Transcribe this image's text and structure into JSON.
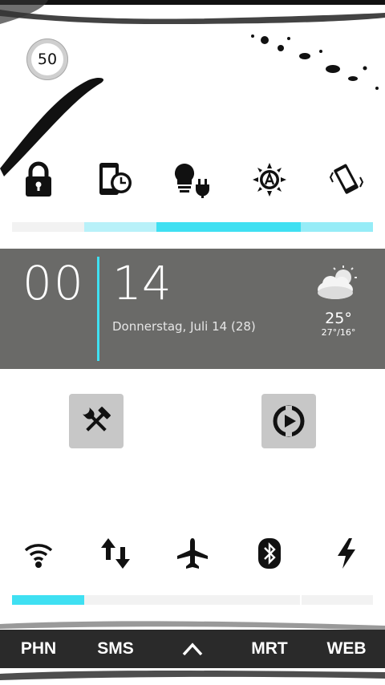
{
  "badge": {
    "value": "50"
  },
  "toggles_top": [
    {
      "icon": "lock-icon"
    },
    {
      "icon": "screen-timeout-icon"
    },
    {
      "icon": "bulb-plug-icon"
    },
    {
      "icon": "auto-brightness-icon"
    },
    {
      "icon": "vibrate-icon"
    }
  ],
  "brightness_bar": {
    "level_start": 0.2,
    "level_end": 1.0,
    "accent": "#3fe0f2"
  },
  "clock": {
    "hours": "00",
    "day": "14",
    "date": "Donnerstag, Juli 14 (28)"
  },
  "weather": {
    "icon": "partly-cloudy-icon",
    "temp": "25°",
    "range": "27°/16°"
  },
  "apps": [
    {
      "icon": "tools-icon"
    },
    {
      "icon": "media-player-icon"
    }
  ],
  "toggles_bottom": [
    {
      "icon": "wifi-icon"
    },
    {
      "icon": "data-transfer-icon"
    },
    {
      "icon": "airplane-icon"
    },
    {
      "icon": "bluetooth-icon"
    },
    {
      "icon": "flash-icon"
    }
  ],
  "wifi_bar": {
    "level": 0.2,
    "accent": "#3fe0f2"
  },
  "dock": {
    "items": [
      "PHN",
      "SMS",
      "^",
      "MRT",
      "WEB"
    ]
  },
  "colors": {
    "panel": "#6a6a68",
    "accent": "#3fe0f2",
    "dock": "#2a2a2a"
  }
}
